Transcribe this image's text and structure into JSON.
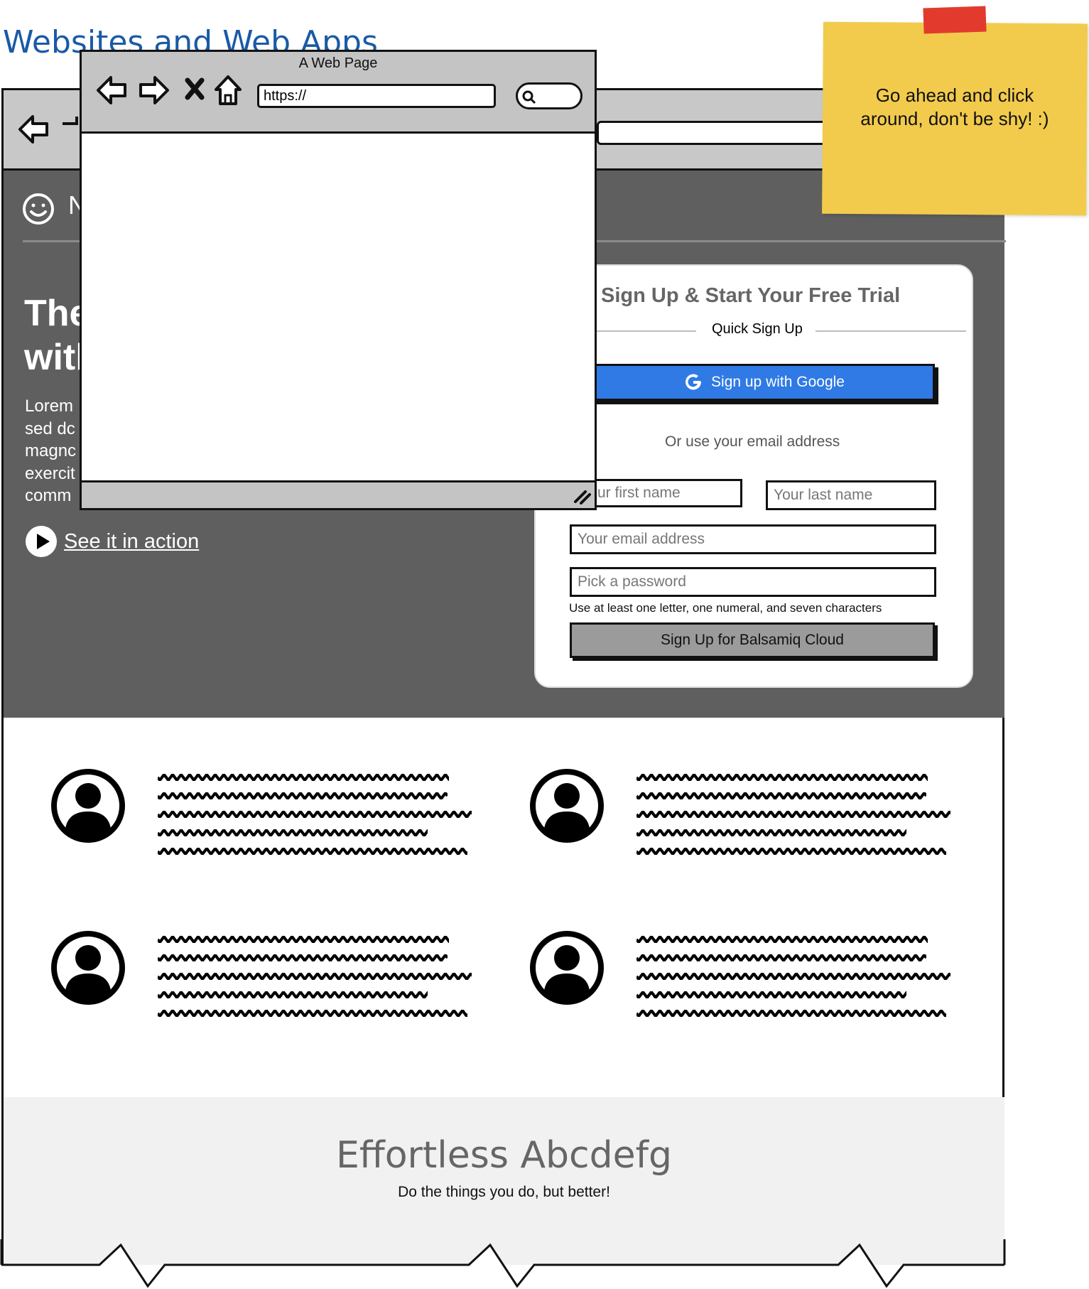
{
  "page_title": "Websites and Web Apps",
  "background_browser": {
    "hero": {
      "logo_text": "N",
      "headline": "The\nwith",
      "lorem": "Lorem\nsed dc\nmagnc\nexercit\ncomm",
      "see_action": "See it in action"
    },
    "signup": {
      "title": "Sign Up & Start Your Free Trial",
      "quick_label": "Quick Sign Up",
      "google_button": "Sign up with Google",
      "or_text": "Or use your email address",
      "first_name_placeholder": "ur first name",
      "last_name_placeholder": "Your last name",
      "email_placeholder": "Your email address",
      "password_placeholder": "Pick a password",
      "hint": "Use at least one letter, one numeral, and seven characters",
      "submit_button": "Sign Up for Balsamiq Cloud"
    },
    "cta": {
      "title": "Effortless Abcdefg",
      "subtitle": "Do the things you do, but better!"
    }
  },
  "front_window": {
    "title": "A Web Page",
    "url": "https://"
  },
  "sticky_note": {
    "text_line1": "Go ahead and click",
    "text_line2": "around, don't be shy! :)"
  },
  "colors": {
    "title_blue": "#1a5aa6",
    "hero_gray": "#5f5f5f",
    "google_blue": "#2f7ae5",
    "sticky_yellow": "#f2cb4d",
    "tape_red": "#e23b2e"
  }
}
